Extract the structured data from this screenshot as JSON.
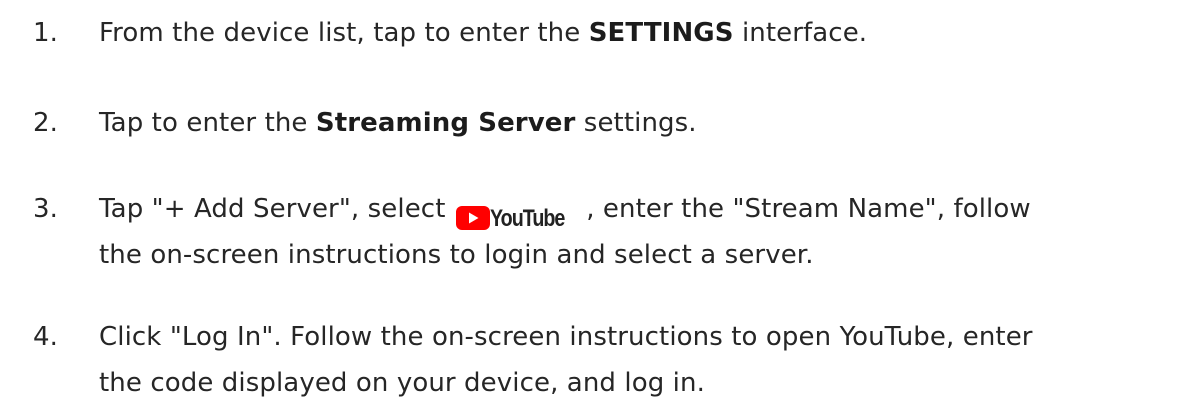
{
  "steps": [
    {
      "number": "1.",
      "before": "From the device list, tap to enter the ",
      "bold": "SETTINGS",
      "after": " interface."
    },
    {
      "number": "2.",
      "before": "Tap to enter the ",
      "bold": "Streaming Server",
      "after": " settings."
    },
    {
      "number": "3.",
      "before": "Tap \"+ Add Server\", select",
      "logo_text": "YouTube",
      "after": ", enter the \"Stream Name\", follow",
      "line2": "the on-screen instructions to login and select a server."
    },
    {
      "number": "4.",
      "line1": "Click \"Log In\". Follow the on-screen instructions to open YouTube, enter",
      "line2": "the code displayed on your device, and log in."
    }
  ],
  "colors": {
    "text": "#262626",
    "youtube_red": "#FF0000"
  },
  "icons": {
    "youtube_logo": "youtube-logo-icon"
  }
}
